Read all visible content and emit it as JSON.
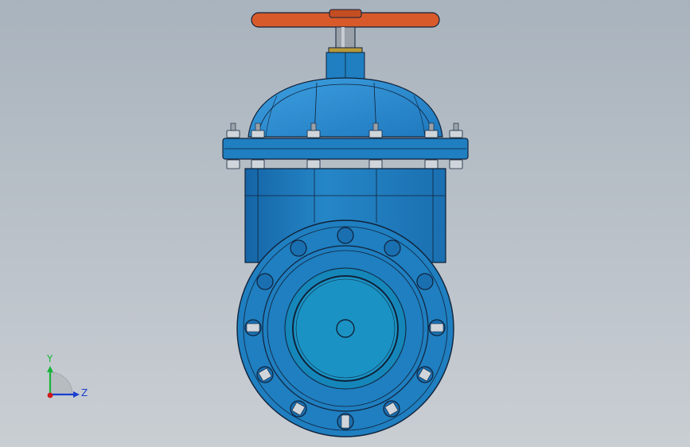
{
  "viewport": {
    "background_top": "#a9b3bd",
    "background_bottom": "#c9ced3"
  },
  "model": {
    "body_color": "#1f7fc0",
    "body_highlight": "#3a9ad6",
    "face_color": "#1a93c4",
    "edge_color": "#10223a",
    "handwheel_color": "#d85a2a",
    "stem_color": "#9aa1a8",
    "gland_color": "#b89a3a",
    "bolt_color": "#cfd5da"
  },
  "triad": {
    "y_label": "Y",
    "z_label": "Z",
    "y_color": "#19b43a",
    "z_color": "#1a3fd0",
    "x_color": "#d01a1a"
  }
}
